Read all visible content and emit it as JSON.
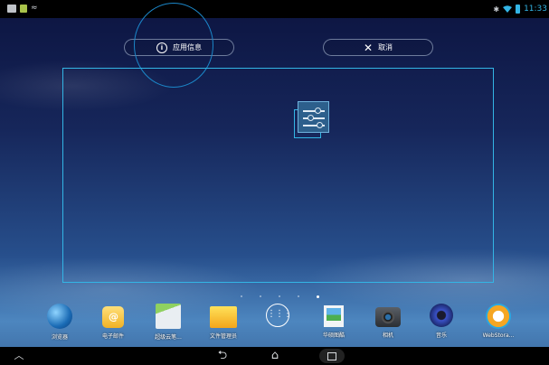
{
  "status_bar": {
    "time": "11:33",
    "icons": [
      "image-icon",
      "document-icon",
      "signal-wave-icon",
      "bluetooth-icon",
      "wifi-icon",
      "battery-icon"
    ]
  },
  "action_bar": {
    "app_info_label": "应用信息",
    "cancel_label": "取消",
    "app_info_icon": "info-icon",
    "cancel_icon": "close-icon"
  },
  "dragged_item": {
    "icon": "settings-icon"
  },
  "page_indicator": {
    "count": 5,
    "active_index": 4
  },
  "dock": {
    "items": [
      {
        "label": "浏览器",
        "icon": "browser-icon"
      },
      {
        "label": "电子邮件",
        "icon": "email-icon"
      },
      {
        "label": "超级云笔...",
        "icon": "cloud-note-icon"
      },
      {
        "label": "文件管理员",
        "icon": "folder-icon"
      },
      {
        "label": "",
        "icon": "apps-grid-icon"
      },
      {
        "label": "华硕图酷",
        "icon": "gallery-icon"
      },
      {
        "label": "相机",
        "icon": "camera-icon"
      },
      {
        "label": "音乐",
        "icon": "music-icon"
      },
      {
        "label": "WebStora...",
        "icon": "webstorage-icon"
      }
    ]
  },
  "nav_bar": {
    "icons": [
      "up-chevron-icon",
      "back-icon",
      "home-icon",
      "recent-apps-icon"
    ]
  },
  "colors": {
    "accent": "#33b5e5",
    "highlight_circle": "#1b87c9",
    "status_bar_bg": "#000000"
  }
}
